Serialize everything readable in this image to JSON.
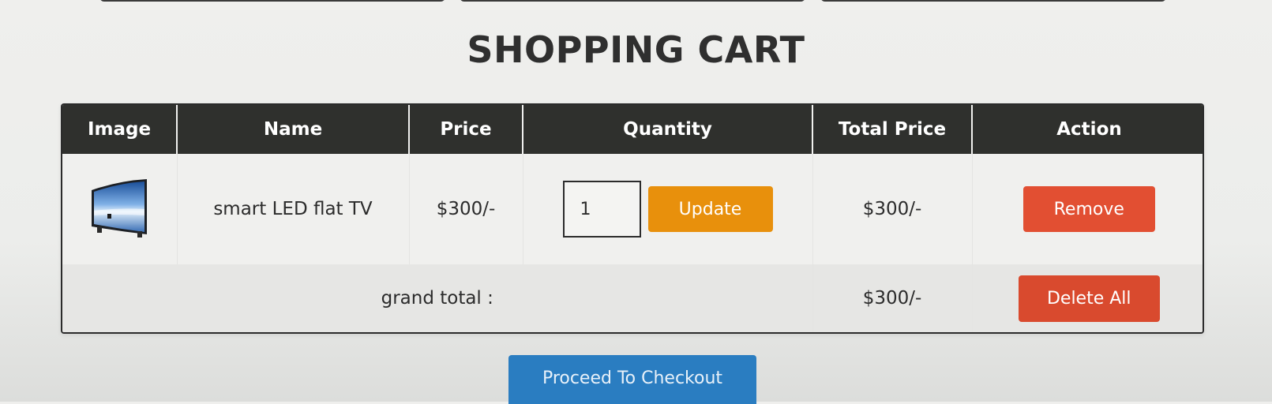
{
  "page": {
    "title": "SHOPPING CART"
  },
  "table": {
    "headers": [
      "Image",
      "Name",
      "Price",
      "Quantity",
      "Total Price",
      "Action"
    ],
    "items": [
      {
        "image_icon": "tv-image",
        "name": "smart LED flat TV",
        "price": "$300/-",
        "quantity": "1",
        "update_label": "Update",
        "total_price": "$300/-",
        "remove_label": "Remove"
      }
    ],
    "grand_total_label": "grand total :",
    "grand_total_value": "$300/-",
    "delete_all_label": "Delete All"
  },
  "checkout": {
    "label": "Proceed To Checkout"
  },
  "colors": {
    "header_bg": "#2f302d",
    "update": "#e8900c",
    "remove": "#e24f32",
    "delete_all": "#d94a2e",
    "checkout": "#2a7dc1"
  }
}
